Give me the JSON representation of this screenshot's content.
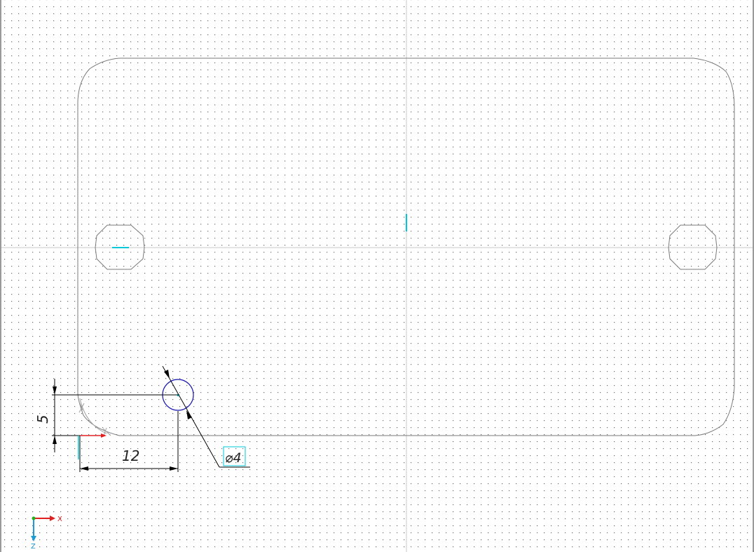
{
  "drawing": {
    "dimensions": {
      "vertical": {
        "value": "5"
      },
      "horizontal": {
        "value": "12"
      },
      "diameter": {
        "value": "⌀4"
      }
    },
    "axis_triad": {
      "x_label": "X",
      "z_label": "Z"
    }
  },
  "colors": {
    "background": "#ffffff",
    "grid_dot": "#6b6b6b",
    "outline": "#7a7a7a",
    "centerline": "#c8c8c8",
    "dimension": "#000000",
    "highlight": "#00c8d8",
    "selected_circle": "#1a1ab0",
    "axis_x": "#e02020",
    "axis_z": "#1e9ad6",
    "origin_dot": "#20b020"
  }
}
